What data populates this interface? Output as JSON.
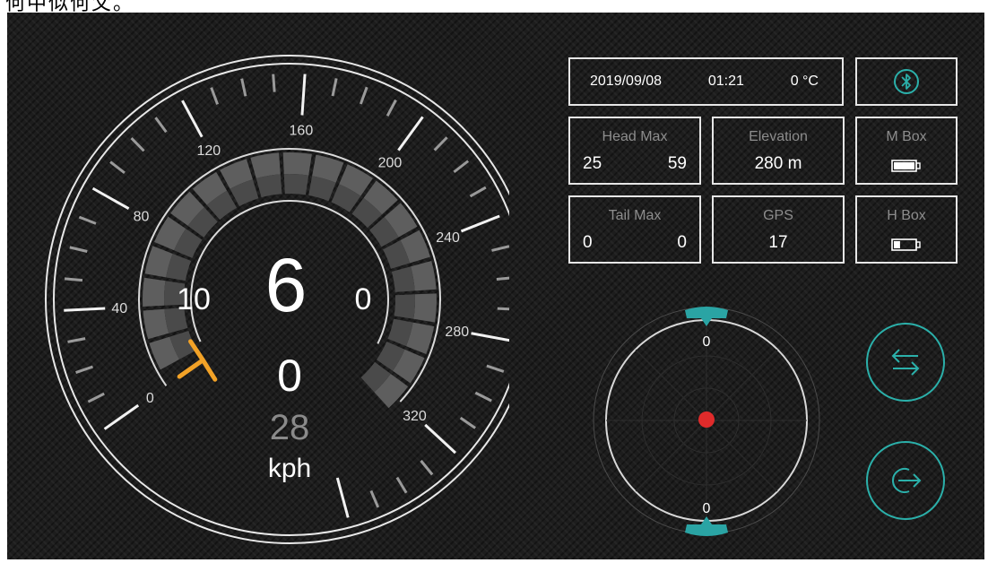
{
  "caption": "何中似何父。",
  "speedometer": {
    "scale_labels": [
      "0",
      "40",
      "80",
      "120",
      "160",
      "200",
      "240",
      "280",
      "320"
    ],
    "left_value": "10",
    "main_value": "6",
    "right_value": "0",
    "secondary_value": "0",
    "tertiary_value": "28",
    "unit": "kph",
    "needle_value_kph": 0,
    "highlighted_segment_kph": 160,
    "colors": {
      "accent": "#3b86d6",
      "needle": "#f2a227",
      "segment": "#6a6a6a"
    }
  },
  "status_bar": {
    "date": "2019/09/08",
    "time": "01:21",
    "temperature": "0 °C"
  },
  "bluetooth": {
    "icon": "bluetooth-icon"
  },
  "info": {
    "head_max": {
      "label": "Head Max",
      "left": "25",
      "right": "59"
    },
    "elevation": {
      "label": "Elevation",
      "value": "280 m"
    },
    "m_box": {
      "label": "M Box",
      "battery_level": 1.0
    },
    "tail_max": {
      "label": "Tail Max",
      "left": "0",
      "right": "0"
    },
    "gps": {
      "label": "GPS",
      "value": "17"
    },
    "h_box": {
      "label": "H Box",
      "battery_level": 0.3
    }
  },
  "compass": {
    "top_value": "0",
    "bottom_value": "0",
    "colors": {
      "marker": "#2aa4a4",
      "dot": "#e02b2b"
    }
  },
  "buttons": {
    "swap": {
      "icon": "swap-arrows-icon"
    },
    "exit": {
      "icon": "exit-icon"
    }
  }
}
